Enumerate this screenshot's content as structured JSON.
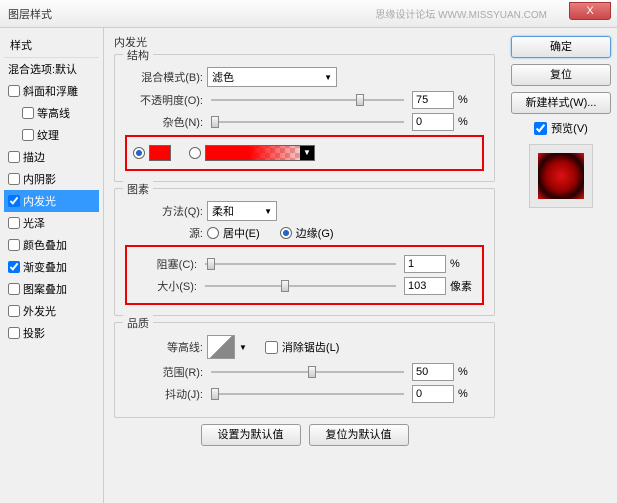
{
  "title": "图层样式",
  "watermark": "思缘设计论坛  WWW.MISSYUAN.COM",
  "closeX": "X",
  "left": {
    "header": "样式",
    "blend": "混合选项:默认",
    "items": [
      "斜面和浮雕",
      "等高线",
      "纹理",
      "描边",
      "内阴影",
      "内发光",
      "光泽",
      "颜色叠加",
      "渐变叠加",
      "图案叠加",
      "外发光",
      "投影"
    ],
    "checked": {
      "5": true,
      "8": true
    }
  },
  "right": {
    "ok": "确定",
    "cancel": "复位",
    "newstyle": "新建样式(W)...",
    "preview": "预览(V)"
  },
  "center": {
    "panelTitle": "内发光",
    "struct": {
      "legend": "结构",
      "blendmode_lbl": "混合模式(B):",
      "blendmode_val": "滤色",
      "opacity_lbl": "不透明度(O):",
      "opacity_val": "75",
      "pct": "%",
      "noise_lbl": "杂色(N):",
      "noise_val": "0"
    },
    "elements": {
      "legend": "图素",
      "method_lbl": "方法(Q):",
      "method_val": "柔和",
      "source_lbl": "源:",
      "centered": "居中(E)",
      "edge": "边缘(G)",
      "choke_lbl": "阻塞(C):",
      "choke_val": "1",
      "size_lbl": "大小(S):",
      "size_val": "103",
      "px": "像素"
    },
    "quality": {
      "legend": "品质",
      "contour_lbl": "等高线:",
      "anti_lbl": "消除锯齿(L)",
      "range_lbl": "范围(R):",
      "range_val": "50",
      "jitter_lbl": "抖动(J):",
      "jitter_val": "0"
    },
    "setdefault": "设置为默认值",
    "resetdefault": "复位为默认值"
  }
}
